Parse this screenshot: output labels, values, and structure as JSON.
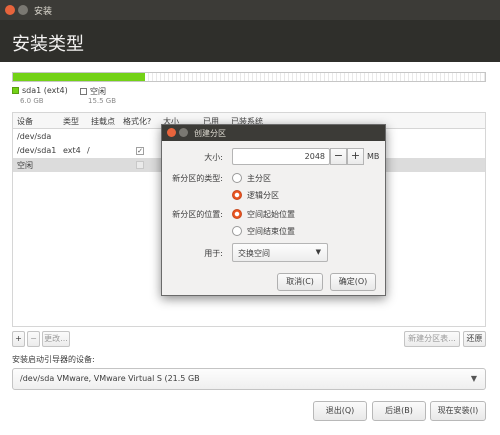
{
  "window": {
    "title": "安装"
  },
  "header": {
    "title": "安装类型"
  },
  "disk_bar": {
    "used_fraction": 0.28,
    "used_color": "#73d216"
  },
  "legend": [
    {
      "name": "sda1 (ext4)",
      "size": "6.0 GB",
      "color": "#73d216"
    },
    {
      "name": "空闲",
      "size": "15.5 GB",
      "color": "#ffffff"
    }
  ],
  "table": {
    "headers": [
      "设备",
      "类型",
      "挂载点",
      "格式化?",
      "大小",
      "已用",
      "已装系统"
    ],
    "rows": [
      {
        "device": "/dev/sda",
        "type": "",
        "mount": "",
        "format": null
      },
      {
        "device": "/dev/sda1",
        "type": "ext4",
        "mount": "/",
        "format": true
      },
      {
        "device": "空闲",
        "type": "",
        "mount": "",
        "format": false
      }
    ],
    "toolbar": {
      "add": "+",
      "remove": "−",
      "change": "更改...",
      "new_table": "新建分区表...",
      "revert": "还原"
    }
  },
  "bootloader": {
    "label": "安装启动引导器的设备:",
    "value": "/dev/sda   VMware, VMware Virtual S (21.5 GB"
  },
  "buttons": {
    "quit": "退出(Q)",
    "back": "后退(B)",
    "install": "现在安装(I)"
  },
  "dialog": {
    "title": "创建分区",
    "size_label": "大小:",
    "size_value": "2048",
    "minus": "−",
    "plus": "+",
    "unit": "MB",
    "type_label": "新分区的类型:",
    "type_primary": "主分区",
    "type_logical": "逻辑分区",
    "type_selected": "logical",
    "location_label": "新分区的位置:",
    "location_start": "空间起始位置",
    "location_end": "空间结束位置",
    "location_selected": "start",
    "use_label": "用于:",
    "use_value": "交换空间",
    "cancel": "取消(C)",
    "ok": "确定(O)"
  },
  "accent_color": "#e95420"
}
